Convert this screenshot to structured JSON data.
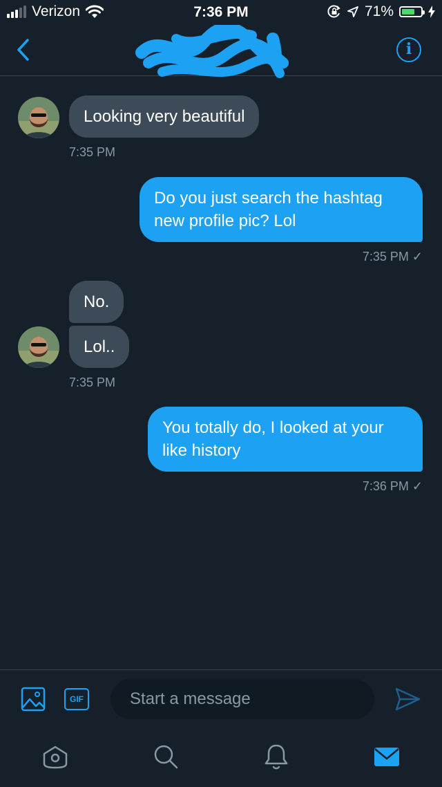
{
  "status_bar": {
    "carrier": "Verizon",
    "time": "7:36 PM",
    "battery": "71%",
    "battery_level": 0.71
  },
  "header": {
    "back_icon": "chevron-left-icon",
    "info_icon": "info-icon",
    "info_glyph": "i"
  },
  "messages": [
    {
      "direction": "incoming",
      "text": "Looking very beautiful"
    },
    {
      "direction": "incoming",
      "timestamp": "7:35 PM"
    },
    {
      "direction": "outgoing",
      "text": "Do you just search the hashtag new profile pic? Lol"
    },
    {
      "direction": "outgoing",
      "timestamp": "7:35 PM ✓"
    },
    {
      "direction": "incoming",
      "text": "No."
    },
    {
      "direction": "incoming",
      "text": "Lol.."
    },
    {
      "direction": "incoming",
      "timestamp": "7:35 PM"
    },
    {
      "direction": "outgoing",
      "text": "You totally do, I looked at your like history"
    },
    {
      "direction": "outgoing",
      "timestamp": "7:36 PM ✓"
    }
  ],
  "composer": {
    "gif_label": "GIF",
    "placeholder": "Start a message",
    "media_icon": "image-icon",
    "send_icon": "send-icon"
  },
  "tabbar": {
    "tabs": [
      {
        "icon": "home-icon",
        "active": false
      },
      {
        "icon": "search-icon",
        "active": false
      },
      {
        "icon": "bell-icon",
        "active": false
      },
      {
        "icon": "mail-icon",
        "active": true
      }
    ]
  },
  "colors": {
    "background": "#15202b",
    "accent": "#1da1f2",
    "incoming_bubble": "#3d4b58",
    "muted_text": "#8899a6",
    "battery_green": "#4cd964"
  }
}
